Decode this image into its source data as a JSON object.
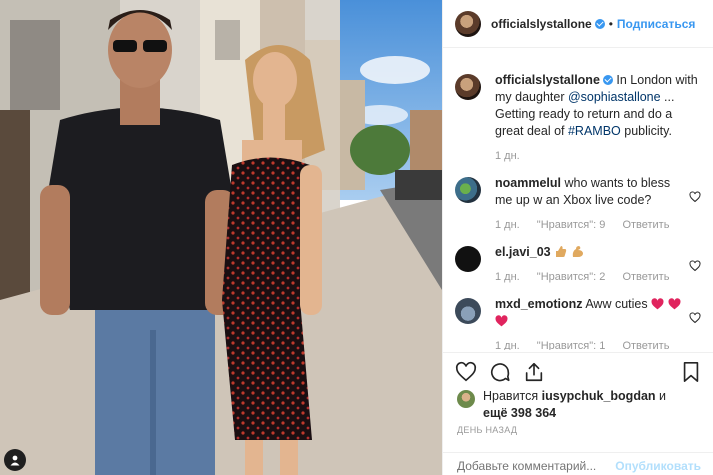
{
  "post": {
    "username": "officialslystallone",
    "follow_label": "Подписаться",
    "dot": "•"
  },
  "caption": {
    "username": "officialslystallone",
    "text_1": "In London with my daughter ",
    "mention": "@sophiastallone",
    "text_2": " ... Getting ready to return and do a great deal of ",
    "hashtag": "#RAMBO",
    "text_3": " publicity.",
    "time": "1 дн."
  },
  "comments": [
    {
      "username": "noammelul",
      "text": "who wants to bless me up w an Xbox live code?",
      "time": "1 дн.",
      "likes": "\"Нравится\": 9",
      "reply": "Ответить"
    },
    {
      "username": "el.javi_03",
      "text": "",
      "time": "1 дн.",
      "likes": "\"Нравится\": 2",
      "reply": "Ответить"
    },
    {
      "username": "mxd_emotionz",
      "text": "Aww cuties",
      "time": "1 дн.",
      "likes": "\"Нравится\": 1",
      "reply": "Ответить"
    }
  ],
  "likes": {
    "prefix": "Нравится ",
    "user": "iusypchuk_bogdan",
    "middle": " и",
    "more": "ещё 398 364"
  },
  "timestamp": "ДЕНЬ НАЗАД",
  "add_comment": {
    "placeholder": "Добавьте комментарий...",
    "publish_label": "Опубликовать"
  },
  "colors": {
    "link": "#003569",
    "accent": "#3897f0",
    "muted": "#999999"
  }
}
